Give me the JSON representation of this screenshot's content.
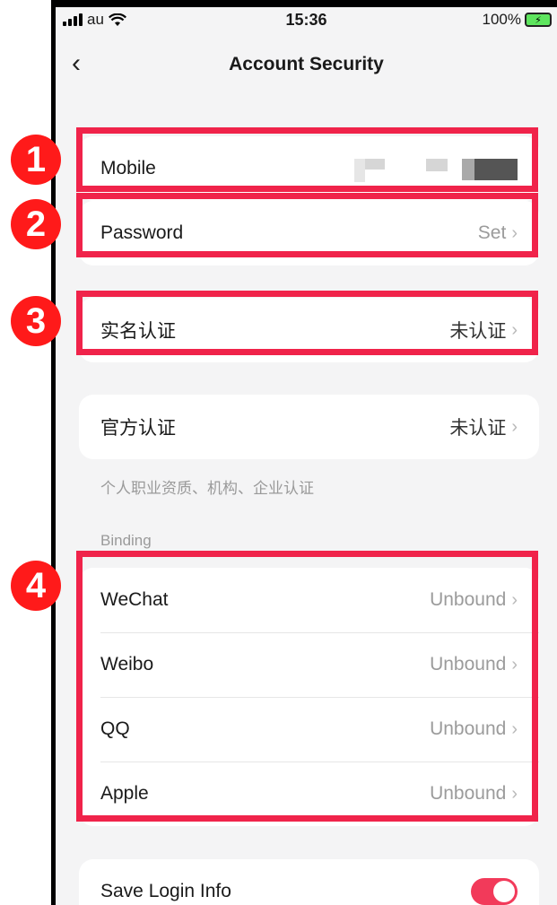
{
  "status": {
    "carrier": "au",
    "time": "15:36",
    "battery": "100%"
  },
  "header": {
    "title": "Account Security"
  },
  "account": {
    "mobile_label": "Mobile",
    "password_label": "Password",
    "password_value": "Set"
  },
  "verification": {
    "label": "实名认证",
    "value": "未认证"
  },
  "official": {
    "label": "官方认证",
    "value": "未认证",
    "note": "个人职业资质、机构、企业认证"
  },
  "binding": {
    "section_label": "Binding",
    "items": [
      {
        "label": "WeChat",
        "value": "Unbound"
      },
      {
        "label": "Weibo",
        "value": "Unbound"
      },
      {
        "label": "QQ",
        "value": "Unbound"
      },
      {
        "label": "Apple",
        "value": "Unbound"
      }
    ]
  },
  "save_login": {
    "label": "Save Login Info",
    "enabled": true
  },
  "annotations": [
    "1",
    "2",
    "3",
    "4"
  ],
  "colors": {
    "highlight": "#f0234a",
    "badge": "#ff1a1a",
    "toggle": "#f23a5a"
  }
}
